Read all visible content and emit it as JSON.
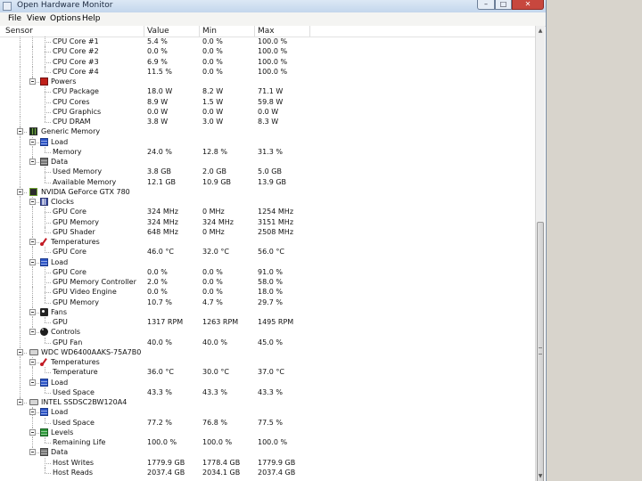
{
  "window": {
    "title": "Open Hardware Monitor",
    "buttons": {
      "minimize": "–",
      "maximize": "□",
      "close": "✕"
    }
  },
  "menu": [
    "File",
    "View",
    "Options",
    "Help"
  ],
  "columns": {
    "sensor": "Sensor",
    "value": "Value",
    "min": "Min",
    "max": "Max"
  },
  "scrollbar": {
    "up": "▲",
    "down": "▼"
  },
  "rows": [
    {
      "depth": 3,
      "kind": "leaf",
      "name": "CPU Core #1",
      "value": "5.4 %",
      "min": "0.0 %",
      "max": "100.0 %"
    },
    {
      "depth": 3,
      "kind": "leaf",
      "name": "CPU Core #2",
      "value": "0.0 %",
      "min": "0.0 %",
      "max": "100.0 %"
    },
    {
      "depth": 3,
      "kind": "leaf",
      "name": "CPU Core #3",
      "value": "6.9 %",
      "min": "0.0 %",
      "max": "100.0 %"
    },
    {
      "depth": 3,
      "kind": "leaf",
      "name": "CPU Core #4",
      "value": "11.5 %",
      "min": "0.0 %",
      "max": "100.0 %"
    },
    {
      "depth": 2,
      "kind": "group",
      "icon": "power",
      "name": "Powers"
    },
    {
      "depth": 3,
      "kind": "leaf",
      "name": "CPU Package",
      "value": "18.0 W",
      "min": "8.2 W",
      "max": "71.1 W"
    },
    {
      "depth": 3,
      "kind": "leaf",
      "name": "CPU Cores",
      "value": "8.9 W",
      "min": "1.5 W",
      "max": "59.8 W"
    },
    {
      "depth": 3,
      "kind": "leaf",
      "name": "CPU Graphics",
      "value": "0.0 W",
      "min": "0.0 W",
      "max": "0.0 W"
    },
    {
      "depth": 3,
      "kind": "leaf",
      "name": "CPU DRAM",
      "value": "3.8 W",
      "min": "3.0 W",
      "max": "8.3 W"
    },
    {
      "depth": 1,
      "kind": "hardware",
      "icon": "mem",
      "name": "Generic Memory"
    },
    {
      "depth": 2,
      "kind": "group",
      "icon": "load",
      "name": "Load"
    },
    {
      "depth": 3,
      "kind": "leaf",
      "name": "Memory",
      "value": "24.0 %",
      "min": "12.8 %",
      "max": "31.3 %"
    },
    {
      "depth": 2,
      "kind": "group",
      "icon": "data",
      "name": "Data"
    },
    {
      "depth": 3,
      "kind": "leaf",
      "name": "Used Memory",
      "value": "3.8 GB",
      "min": "2.0 GB",
      "max": "5.0 GB"
    },
    {
      "depth": 3,
      "kind": "leaf",
      "name": "Available Memory",
      "value": "12.1 GB",
      "min": "10.9 GB",
      "max": "13.9 GB"
    },
    {
      "depth": 1,
      "kind": "hardware",
      "icon": "gpu",
      "name": "NVIDIA GeForce GTX 780"
    },
    {
      "depth": 2,
      "kind": "group",
      "icon": "clock",
      "name": "Clocks"
    },
    {
      "depth": 3,
      "kind": "leaf",
      "name": "GPU Core",
      "value": "324 MHz",
      "min": "0 MHz",
      "max": "1254 MHz"
    },
    {
      "depth": 3,
      "kind": "leaf",
      "name": "GPU Memory",
      "value": "324 MHz",
      "min": "324 MHz",
      "max": "3151 MHz"
    },
    {
      "depth": 3,
      "kind": "leaf",
      "name": "GPU Shader",
      "value": "648 MHz",
      "min": "0 MHz",
      "max": "2508 MHz"
    },
    {
      "depth": 2,
      "kind": "group",
      "icon": "temp",
      "name": "Temperatures"
    },
    {
      "depth": 3,
      "kind": "leaf",
      "name": "GPU Core",
      "value": "46.0 °C",
      "min": "32.0 °C",
      "max": "56.0 °C"
    },
    {
      "depth": 2,
      "kind": "group",
      "icon": "load",
      "name": "Load"
    },
    {
      "depth": 3,
      "kind": "leaf",
      "name": "GPU Core",
      "value": "0.0 %",
      "min": "0.0 %",
      "max": "91.0 %"
    },
    {
      "depth": 3,
      "kind": "leaf",
      "name": "GPU Memory Controller",
      "value": "2.0 %",
      "min": "0.0 %",
      "max": "58.0 %"
    },
    {
      "depth": 3,
      "kind": "leaf",
      "name": "GPU Video Engine",
      "value": "0.0 %",
      "min": "0.0 %",
      "max": "18.0 %"
    },
    {
      "depth": 3,
      "kind": "leaf",
      "name": "GPU Memory",
      "value": "10.7 %",
      "min": "4.7 %",
      "max": "29.7 %"
    },
    {
      "depth": 2,
      "kind": "group",
      "icon": "fan",
      "name": "Fans"
    },
    {
      "depth": 3,
      "kind": "leaf",
      "name": "GPU",
      "value": "1317 RPM",
      "min": "1263 RPM",
      "max": "1495 RPM"
    },
    {
      "depth": 2,
      "kind": "group",
      "icon": "ctrl",
      "name": "Controls"
    },
    {
      "depth": 3,
      "kind": "leaf",
      "name": "GPU Fan",
      "value": "40.0 %",
      "min": "40.0 %",
      "max": "45.0 %"
    },
    {
      "depth": 1,
      "kind": "hardware",
      "icon": "disk",
      "name": "WDC WD6400AAKS-75A7B0"
    },
    {
      "depth": 2,
      "kind": "group",
      "icon": "temp",
      "name": "Temperatures"
    },
    {
      "depth": 3,
      "kind": "leaf",
      "name": "Temperature",
      "value": "36.0 °C",
      "min": "30.0 °C",
      "max": "37.0 °C"
    },
    {
      "depth": 2,
      "kind": "group",
      "icon": "load",
      "name": "Load"
    },
    {
      "depth": 3,
      "kind": "leaf",
      "name": "Used Space",
      "value": "43.3 %",
      "min": "43.3 %",
      "max": "43.3 %"
    },
    {
      "depth": 1,
      "kind": "hardware",
      "icon": "disk",
      "name": "INTEL SSDSC2BW120A4"
    },
    {
      "depth": 2,
      "kind": "group",
      "icon": "load",
      "name": "Load"
    },
    {
      "depth": 3,
      "kind": "leaf",
      "name": "Used Space",
      "value": "77.2 %",
      "min": "76.8 %",
      "max": "77.5 %"
    },
    {
      "depth": 2,
      "kind": "group",
      "icon": "levels",
      "name": "Levels"
    },
    {
      "depth": 3,
      "kind": "leaf",
      "name": "Remaining Life",
      "value": "100.0 %",
      "min": "100.0 %",
      "max": "100.0 %"
    },
    {
      "depth": 2,
      "kind": "group",
      "icon": "data",
      "name": "Data"
    },
    {
      "depth": 3,
      "kind": "leaf",
      "name": "Host Writes",
      "value": "1779.9 GB",
      "min": "1778.4 GB",
      "max": "1779.9 GB"
    },
    {
      "depth": 3,
      "kind": "leaf",
      "name": "Host Reads",
      "value": "2037.4 GB",
      "min": "2034.1 GB",
      "max": "2037.4 GB"
    }
  ]
}
